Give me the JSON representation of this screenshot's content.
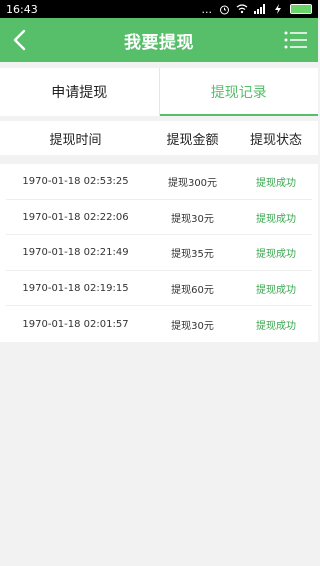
{
  "status_bar": {
    "time": "16:43",
    "dots": "...",
    "battery_level": 1.0
  },
  "header": {
    "title": "我要提现",
    "back_icon": "chevron-left-icon",
    "menu_icon": "menu-icon",
    "color": "#57be6a"
  },
  "tabs": [
    {
      "label": "申请提现",
      "active": false
    },
    {
      "label": "提现记录",
      "active": true
    }
  ],
  "columns": {
    "time": "提现时间",
    "amount": "提现金额",
    "status": "提现状态"
  },
  "records": [
    {
      "time": "1970-01-18 02:53:25",
      "amount": "提现300元",
      "status": "提现成功"
    },
    {
      "time": "1970-01-18 02:22:06",
      "amount": "提现30元",
      "status": "提现成功"
    },
    {
      "time": "1970-01-18 02:21:49",
      "amount": "提现35元",
      "status": "提现成功"
    },
    {
      "time": "1970-01-18 02:19:15",
      "amount": "提现60元",
      "status": "提现成功"
    },
    {
      "time": "1970-01-18 02:01:57",
      "amount": "提现30元",
      "status": "提现成功"
    }
  ],
  "colors": {
    "accent": "#57be6a",
    "success_text": "#3aa84f"
  }
}
